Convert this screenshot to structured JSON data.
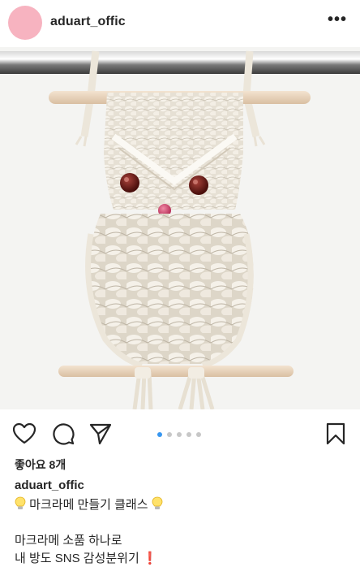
{
  "header": {
    "username": "aduart_offic",
    "more_label": "•••",
    "avatar_color": "#f7b3c0"
  },
  "post": {
    "image_alt": "macrame owl wall hanging",
    "carousel": {
      "count": 5,
      "active": 1,
      "active_color": "#3897f0"
    }
  },
  "actions": {
    "like_icon": "heart-icon",
    "comment_icon": "comment-icon",
    "share_icon": "paper-plane-icon",
    "save_icon": "bookmark-icon"
  },
  "likes": {
    "text": "좋아요 8개"
  },
  "caption": {
    "username": "aduart_offic",
    "line1_text": "마크라메 만들기 클래스",
    "line1_icon": "lightbulb-icon",
    "line2_text": "마크라메 소품 하나로",
    "line3_text": "내 방도 SNS 감성분위기",
    "line3_icon": "exclamation-icon",
    "line3_icon_glyph": "❗"
  }
}
